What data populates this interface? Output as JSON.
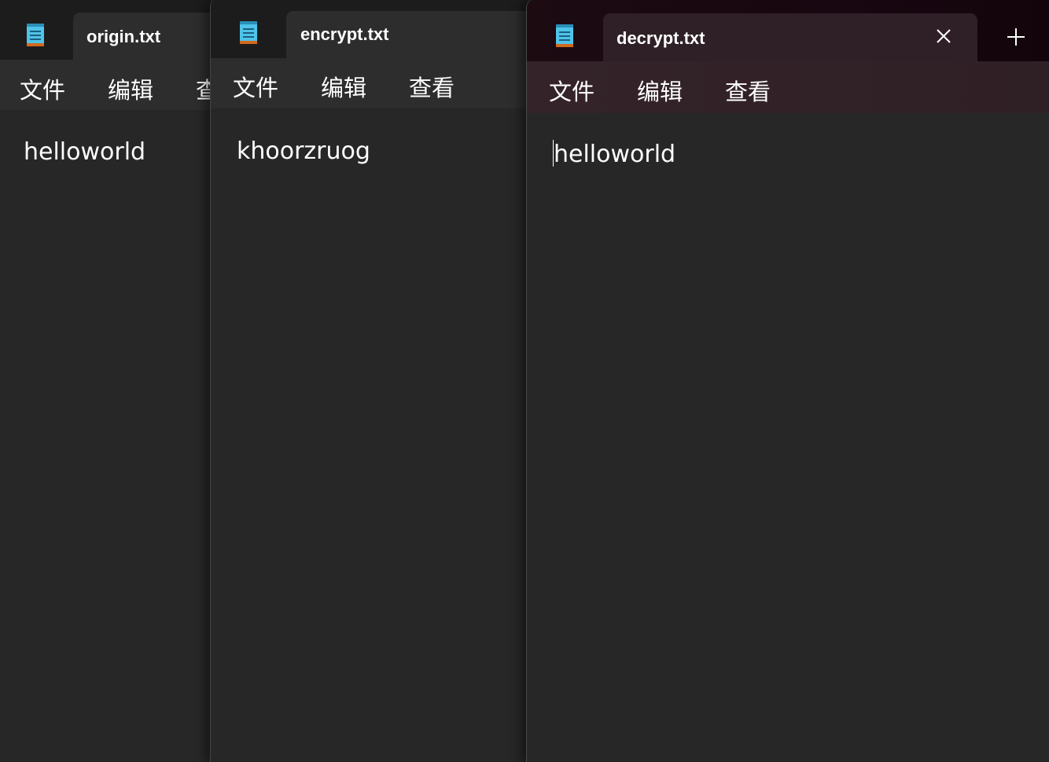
{
  "windows": [
    {
      "tab_title": "origin.txt",
      "menu": [
        "文件",
        "编辑",
        "查"
      ],
      "content": "helloworld"
    },
    {
      "tab_title": "encrypt.txt",
      "menu": [
        "文件",
        "编辑",
        "查看"
      ],
      "content": "khoorzruog"
    },
    {
      "tab_title": "decrypt.txt",
      "menu": [
        "文件",
        "编辑",
        "查看"
      ],
      "content": "helloworld"
    }
  ],
  "icons": {
    "app": "notepad-icon",
    "close": "close-icon",
    "new_tab": "plus-icon"
  },
  "colors": {
    "background": "#272727",
    "titlebar": "#1c1c1c",
    "active_titlebar": "#180610",
    "notepad_icon": "#4fc3e8"
  }
}
